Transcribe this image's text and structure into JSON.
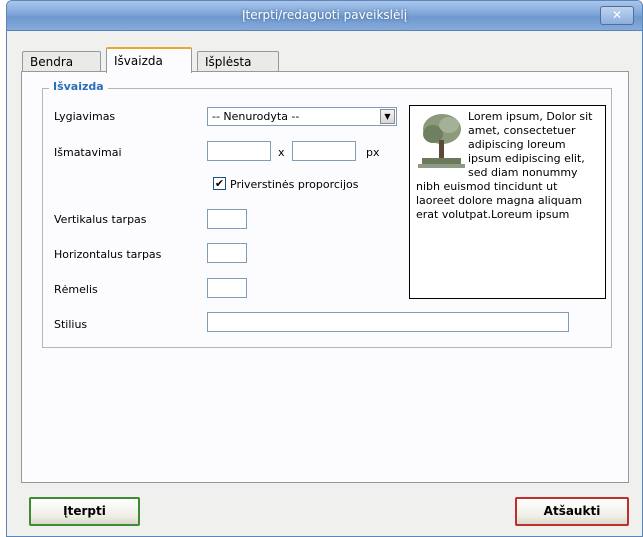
{
  "window": {
    "title": "Įterpti/redaguoti paveikslėlį",
    "close_symbol": "✕"
  },
  "tabs": [
    {
      "label": "Bendra"
    },
    {
      "label": "Išvaizda",
      "active": true
    },
    {
      "label": "Išplėsta"
    }
  ],
  "appearance": {
    "legend": "Išvaizda",
    "alignment_label": "Lygiavimas",
    "alignment_value": "-- Nenurodyta --",
    "dimensions_label": "Išmatavimai",
    "width_value": "",
    "height_value": "",
    "dim_separator": "x",
    "dim_unit": "px",
    "constrain_label": "Priverstinės proporcijos",
    "constrain_checked": true,
    "vspace_label": "Vertikalus tarpas",
    "hspace_label": "Horizontalus tarpas",
    "border_label": "Rėmelis",
    "style_label": "Stilius",
    "vspace_value": "",
    "hspace_value": "",
    "border_value": "",
    "style_value": ""
  },
  "preview": {
    "text": "Lorem ipsum, Dolor sit amet, consectetuer adipiscing loreum ipsum edipiscing elit, sed diam nonummy nibh euismod tincidunt ut laoreet dolore magna aliquam erat volutpat.Loreum ipsum"
  },
  "buttons": {
    "insert": "Įterpti",
    "cancel": "Atšaukti"
  },
  "colors": {
    "legend": "#2b6fb6",
    "tab_highlight": "#e6a830",
    "insert_border": "#3f8a32",
    "cancel_border": "#c0302b"
  },
  "icons": {
    "preview_image": "tree-icon",
    "close": "close-icon"
  }
}
